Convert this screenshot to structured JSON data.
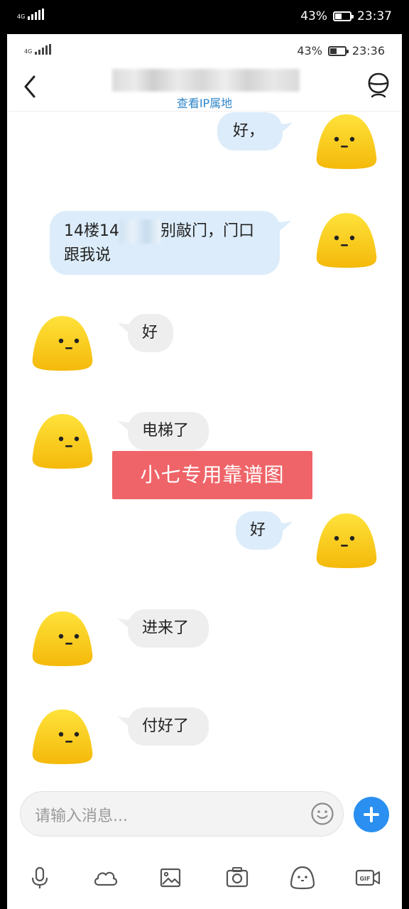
{
  "outer_status": {
    "network": "4G",
    "battery": "43%",
    "battery_level": 0.43,
    "time": "23:37"
  },
  "inner_status": {
    "network": "4G",
    "battery": "43%",
    "battery_level": 0.43,
    "time": "23:36"
  },
  "header": {
    "subtitle_link": "查看IP属地"
  },
  "messages": [
    {
      "side": "me",
      "text": "好，"
    },
    {
      "side": "me",
      "text_part1": "14楼14",
      "text_part2": "别敲门，门口",
      "text_line2": "跟我说"
    },
    {
      "side": "other",
      "text": "好"
    },
    {
      "side": "other",
      "text": "电梯了"
    },
    {
      "side": "me",
      "text": "好"
    },
    {
      "side": "other",
      "text": "进来了"
    },
    {
      "side": "other",
      "text": "付好了"
    }
  ],
  "watermark": "小七专用靠谱图",
  "input": {
    "placeholder": "请输入消息..."
  },
  "toolbar": [
    "microphone-icon",
    "cloud-icon",
    "image-icon",
    "camera-icon",
    "emoji-icon",
    "gif-video-icon"
  ],
  "colors": {
    "accent_blue": "#2a8ff0",
    "link_blue": "#2f86c9",
    "my_bubble": "#dcecfa",
    "other_bubble": "#eeeeee",
    "watermark_red": "#ef6468",
    "avatar_yellow": "#f9c711"
  }
}
